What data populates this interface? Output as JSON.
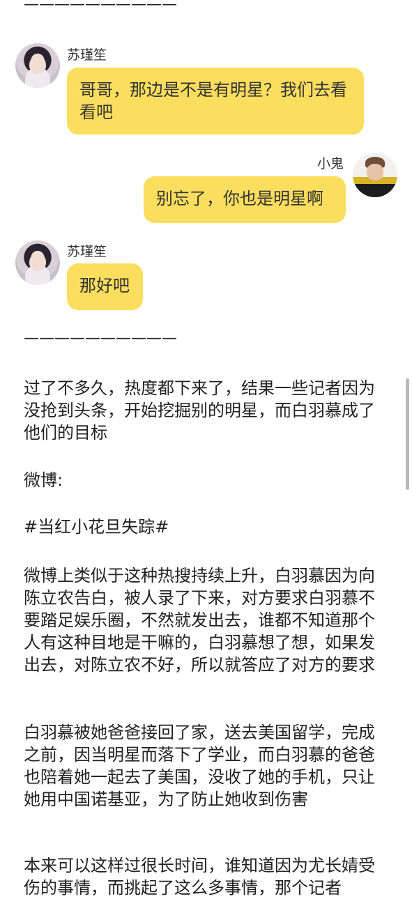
{
  "divider_text": "——————————",
  "messages": [
    {
      "sender": "苏瑾笙",
      "text": "哥哥，那边是不是有明星？我们去看看吧",
      "avatar": "female-avatar-photo"
    },
    {
      "sender": "小鬼",
      "text": "别忘了，你也是明星啊",
      "avatar": "male-avatar-photo"
    },
    {
      "sender": "苏瑾笙",
      "text": "那好吧",
      "avatar": "female-avatar-photo"
    }
  ],
  "paragraphs": [
    "过了不多久，热度都下来了，结果一些记者因为没抢到头条，开始挖掘别的明星，而白羽慕成了他们的目标",
    "微博:",
    "#当红小花旦失踪#",
    "微博上类似于这种热搜持续上升，白羽慕因为向陈立农告白，被人录了下来，对方要求白羽慕不要踏足娱乐圈，不然就发出去，谁都不知道那个人有这种目地是干嘛的，白羽慕想了想，如果发出去，对陈立农不好，所以就答应了对方的要求",
    "白羽慕被她爸爸接回了家，送去美国留学，完成之前，因当明星而落下了学业，而白羽慕的爸爸也陪着她一起去了美国，没收了她的手机，只让她用中国诺基亚，为了防止她收到伤害",
    "本来可以这样过很长时间，谁知道因为尤长婧受伤的事情，而挑起了这么多事情，那个记者"
  ],
  "colors": {
    "bubble": "#fbde5d",
    "background": "#ffffff",
    "text": "#222222"
  }
}
